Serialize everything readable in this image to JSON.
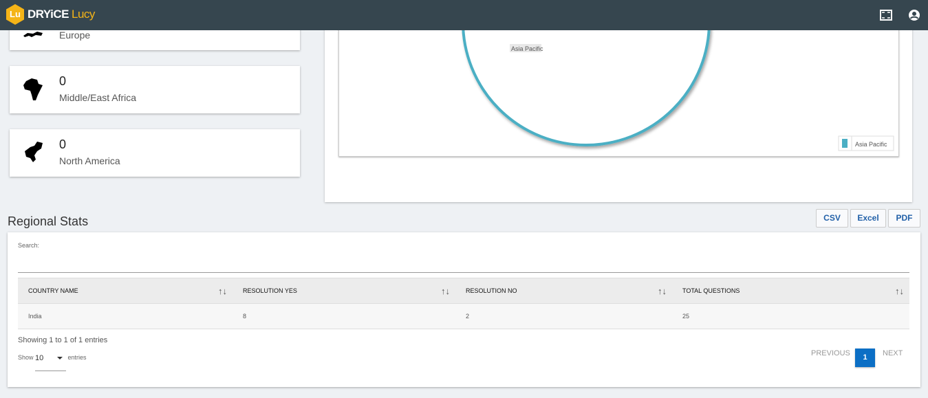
{
  "header": {
    "logo_mark": "Lu",
    "brand": "DRYiCE",
    "product": "Lucy"
  },
  "regions": [
    {
      "count": "",
      "name": "Europe"
    },
    {
      "count": "0",
      "name": "Middle/East Africa"
    },
    {
      "count": "0",
      "name": "North America"
    }
  ],
  "chart_data": {
    "type": "pie",
    "categories": [
      "Asia Pacific"
    ],
    "values": [
      100
    ],
    "slice_label": "Asia Pacific",
    "legend": [
      "Asia Pacific"
    ],
    "legend_position": "bottom-right",
    "colors": [
      "#4bafc4"
    ]
  },
  "stats": {
    "title": "Regional Stats",
    "export": {
      "csv": "CSV",
      "excel": "Excel",
      "pdf": "PDF"
    },
    "search_label": "Search:",
    "search_value": "",
    "columns": [
      "COUNTRY NAME",
      "RESOLUTION YES",
      "RESOLUTION NO",
      "TOTAL QUESTIONS"
    ],
    "rows": [
      [
        "India",
        "8",
        "2",
        "25"
      ]
    ],
    "info": "Showing 1 to 1 of 1 entries",
    "show_label": "Show",
    "page_size": "10",
    "entries_label": "entries",
    "pagination": {
      "previous": "PREVIOUS",
      "current": "1",
      "next": "NEXT"
    }
  }
}
